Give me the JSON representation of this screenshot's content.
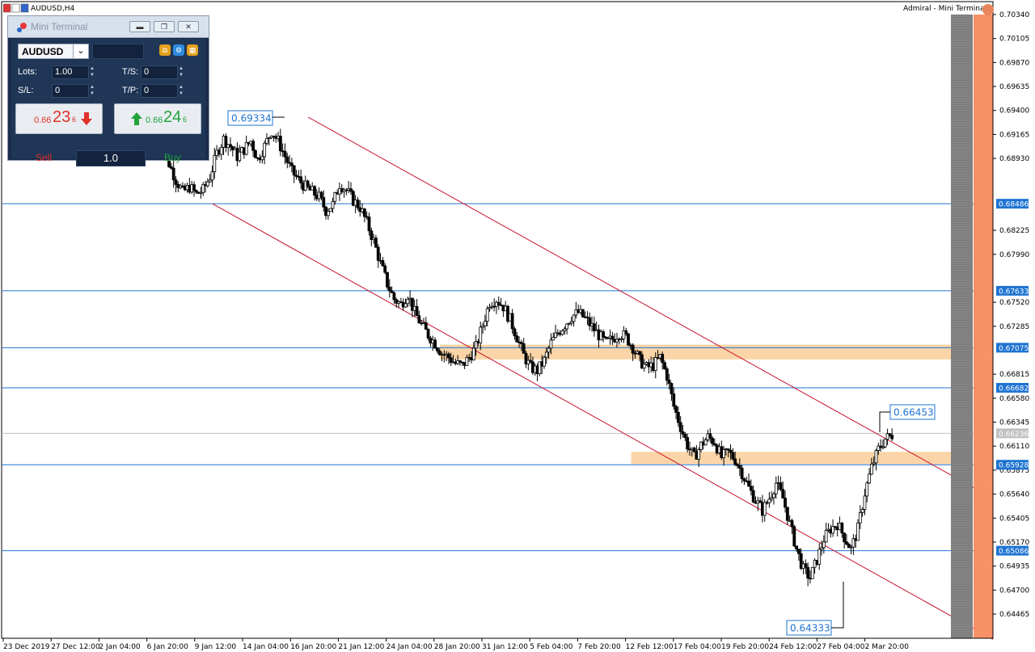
{
  "window": {
    "symbol_title": "AUDUSD,H4",
    "indicator_title": "Admiral - Mini Terminal"
  },
  "mini_terminal": {
    "title": "Mini Terminal",
    "symbol": "AUDUSD",
    "lots_label": "Lots:",
    "lots_value": "1.00",
    "ts_label": "T/S:",
    "ts_value": "0",
    "sl_label": "S/L:",
    "sl_value": "0",
    "tp_label": "T/P:",
    "tp_value": "0",
    "sell": {
      "small": "0.66",
      "big": "23",
      "sup": "6",
      "label": "Sell"
    },
    "buy": {
      "small": "0.66",
      "big": "24",
      "sup": "6",
      "label": "Buy"
    },
    "volume": "1.0"
  },
  "colors": {
    "bull": "#ffffff",
    "bear": "#000000",
    "hline": "#1e73d2",
    "channel": "#c8102e",
    "zone": "#f9c78a",
    "sell": "#e0302a",
    "buy": "#21a33c",
    "label_box": "#1e73d2"
  },
  "chart_data": {
    "type": "candlestick",
    "symbol": "AUDUSD",
    "timeframe": "H4",
    "ylim": [
      0.6433,
      0.7034
    ],
    "y_ticks": [
      0.7034,
      0.70105,
      0.6987,
      0.69635,
      0.694,
      0.69165,
      0.6893,
      0.68225,
      0.6799,
      0.6752,
      0.67285,
      0.66815,
      0.6658,
      0.66345,
      0.6611,
      0.65875,
      0.6564,
      0.65405,
      0.6517,
      0.64935,
      0.647,
      0.64465
    ],
    "x_labels": [
      "23 Dec 2019",
      "27 Dec 12:00",
      "2 Jan 04:00",
      "6 Jan 20:00",
      "9 Jan 12:00",
      "14 Jan 04:00",
      "16 Jan 20:00",
      "21 Jan 12:00",
      "24 Jan 04:00",
      "28 Jan 20:00",
      "31 Jan 12:00",
      "5 Feb 04:00",
      "7 Feb 20:00",
      "12 Feb 12:00",
      "17 Feb 04:00",
      "19 Feb 20:00",
      "24 Feb 12:00",
      "27 Feb 04:00",
      "2 Mar 20:00"
    ],
    "horizontal_levels": [
      {
        "value": 0.68486,
        "label": "0.68486"
      },
      {
        "value": 0.67633,
        "label": "0.67633"
      },
      {
        "value": 0.67075,
        "label": "0.67075"
      },
      {
        "value": 0.66682,
        "label": "0.66682"
      },
      {
        "value": 0.65928,
        "label": "0.65928"
      },
      {
        "value": 0.65086,
        "label": "0.65086"
      }
    ],
    "current_price": {
      "value": 0.66236,
      "label": "0.66236"
    },
    "zones": [
      {
        "from_label": "28 Jan 20:00",
        "y_top": 0.67105,
        "y_bottom": 0.6696
      },
      {
        "from_label": "12 Feb 12:00",
        "y_top": 0.66055,
        "y_bottom": 0.65935
      }
    ],
    "price_labels": [
      {
        "label": "0.69334",
        "value": 0.69334,
        "anchor": "high"
      },
      {
        "label": "0.66453",
        "value": 0.66453,
        "anchor": "high"
      },
      {
        "label": "0.64333",
        "value": 0.64333,
        "anchor": "low"
      }
    ],
    "channel": {
      "upper": {
        "from": {
          "x_label": "16 Jan 20:00",
          "value": 0.69334
        },
        "to": {
          "x_label": "2 Mar 20:00",
          "value": 0.662
        }
      },
      "lower": {
        "from": {
          "x_label": "9 Jan 12:00",
          "value": 0.68486
        },
        "to": {
          "x_label": "2 Mar 20:00",
          "value": 0.6482
        }
      }
    },
    "trend_points": [
      0.6912,
      0.6905,
      0.6888,
      0.6872,
      0.686,
      0.6865,
      0.6858,
      0.6862,
      0.6875,
      0.6898,
      0.6912,
      0.6905,
      0.6895,
      0.6902,
      0.691,
      0.6892,
      0.6905,
      0.692,
      0.691,
      0.6895,
      0.688,
      0.6872,
      0.6865,
      0.686,
      0.6855,
      0.6842,
      0.6848,
      0.6868,
      0.6862,
      0.6852,
      0.6845,
      0.683,
      0.6812,
      0.679,
      0.677,
      0.6755,
      0.675,
      0.676,
      0.6742,
      0.673,
      0.672,
      0.6712,
      0.6702,
      0.6698,
      0.6692,
      0.669,
      0.6698,
      0.6708,
      0.673,
      0.6752,
      0.6755,
      0.6748,
      0.6735,
      0.6718,
      0.67,
      0.6688,
      0.6685,
      0.6695,
      0.6712,
      0.6722,
      0.673,
      0.6738,
      0.6742,
      0.6736,
      0.6728,
      0.672,
      0.6712,
      0.6716,
      0.6722,
      0.6718,
      0.6708,
      0.6695,
      0.6688,
      0.669,
      0.6698,
      0.668,
      0.665,
      0.663,
      0.6612,
      0.66,
      0.6612,
      0.662,
      0.6615,
      0.66,
      0.6605,
      0.6598,
      0.6585,
      0.657,
      0.6558,
      0.6548,
      0.656,
      0.6575,
      0.656,
      0.6535,
      0.651,
      0.649,
      0.6482,
      0.65,
      0.652,
      0.653,
      0.6535,
      0.6522,
      0.651,
      0.653,
      0.6565,
      0.659,
      0.6608,
      0.6618,
      0.6622
    ]
  }
}
